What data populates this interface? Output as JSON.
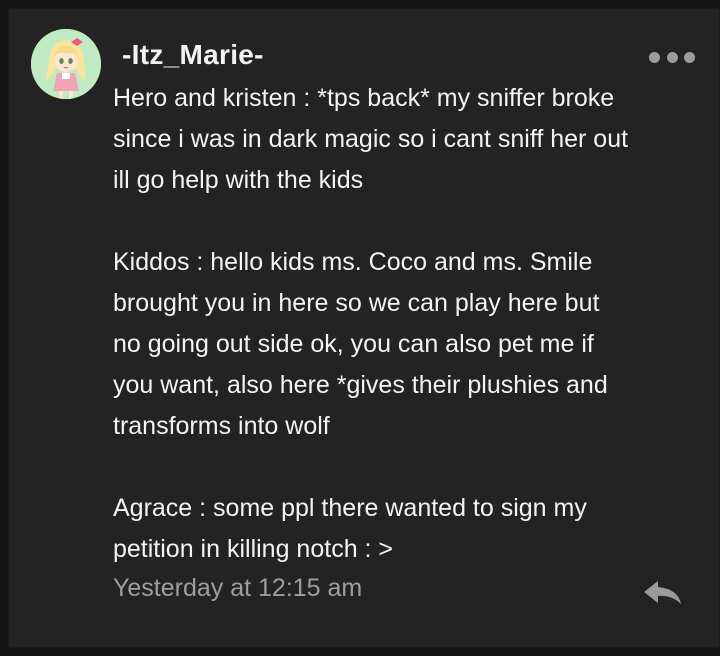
{
  "comment": {
    "username": "-Itz_Marie-",
    "avatar_icon": "anime-girl-avatar-icon",
    "more_icon": "more-options-icon",
    "body_lines": [
      "Hero and kristen : *tps back* my sniffer broke",
      "since i was in dark magic so i cant sniff her out",
      "ill go help with the kids",
      "",
      "Kiddos : hello kids ms. Coco and ms. Smile",
      "brought you in here so we can play here but",
      "no going out side ok, you can also pet me if",
      "you want, also here *gives their plushies and",
      "transforms into wolf",
      "",
      "Agrace : some ppl there wanted to sign my",
      "petition in killing notch : >"
    ],
    "timestamp": "Yesterday at 12:15 am",
    "reply_icon": "reply-arrow-icon"
  },
  "colors": {
    "background": "#141414",
    "card": "#232323",
    "text": "#f3f3f3",
    "muted": "#9e9e9e"
  }
}
